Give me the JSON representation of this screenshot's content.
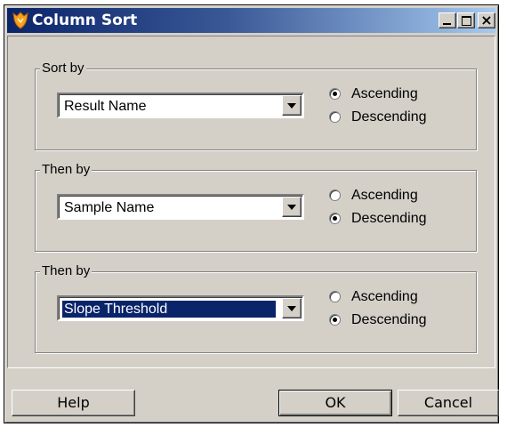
{
  "window": {
    "title": "Column Sort"
  },
  "sort_groups": [
    {
      "label": "Sort by",
      "selected_column": "Result Name",
      "highlighted": false,
      "options": [
        {
          "label": "Ascending",
          "checked": true
        },
        {
          "label": "Descending",
          "checked": false
        }
      ]
    },
    {
      "label": "Then by",
      "selected_column": "Sample Name",
      "highlighted": false,
      "options": [
        {
          "label": "Ascending",
          "checked": false
        },
        {
          "label": "Descending",
          "checked": true
        }
      ]
    },
    {
      "label": "Then by",
      "selected_column": "Slope Threshold",
      "highlighted": true,
      "options": [
        {
          "label": "Ascending",
          "checked": false
        },
        {
          "label": "Descending",
          "checked": true
        }
      ]
    }
  ],
  "buttons": {
    "help": "Help",
    "ok": "OK",
    "cancel": "Cancel"
  },
  "icons": {
    "app": "app-shield-icon",
    "minimize": "minimize-icon",
    "maximize": "maximize-icon",
    "close": "close-icon",
    "dropdown": "chevron-down-icon"
  },
  "colors": {
    "titlebar_start": "#0a246a",
    "titlebar_end": "#a6caf0",
    "dialog_bg": "#d4d0c8",
    "selection": "#0a246a"
  }
}
